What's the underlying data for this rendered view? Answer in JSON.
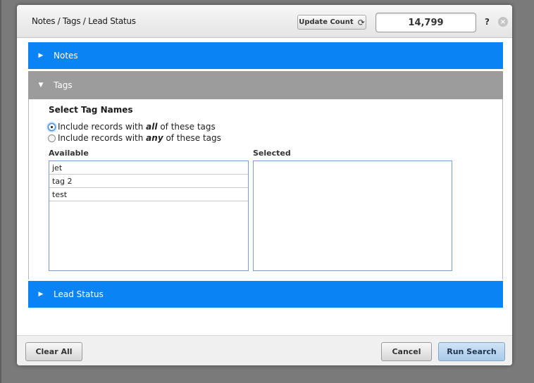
{
  "dialog": {
    "title": "Notes / Tags / Lead Status",
    "update_count_label": "Update Count",
    "count_value": "14,799",
    "help_label": "?",
    "close_label": "×"
  },
  "sections": {
    "notes": {
      "label": "Notes",
      "expanded": false
    },
    "tags": {
      "label": "Tags",
      "expanded": true
    },
    "lead_status": {
      "label": "Lead Status",
      "expanded": false
    }
  },
  "tags": {
    "heading": "Select Tag Names",
    "option_all": {
      "prefix": "Include records with ",
      "emphasis": "all",
      "suffix": " of these tags",
      "selected": true
    },
    "option_any": {
      "prefix": "Include records with ",
      "emphasis": "any",
      "suffix": " of these tags",
      "selected": false
    },
    "available_label": "Available",
    "selected_label": "Selected",
    "available_items": [
      "jet",
      "tag 2",
      "test"
    ],
    "selected_items": []
  },
  "footer": {
    "clear_all": "Clear All",
    "cancel": "Cancel",
    "run_search": "Run Search"
  },
  "colors": {
    "section_blue": "#0a84f5",
    "section_gray": "#9c9c9c"
  }
}
